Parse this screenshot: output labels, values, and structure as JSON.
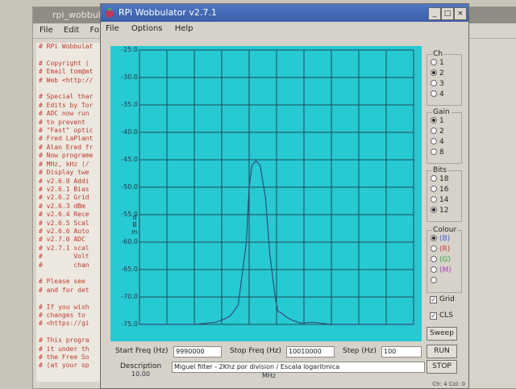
{
  "background_window": {
    "title": "rpi_wobbulator",
    "menu": [
      "File",
      "Edit",
      "Form"
    ],
    "text_lines": [
      "# RPi Wobbulat",
      "",
      "# Copyright (",
      "# Email tom@at",
      "# Web <http://",
      "",
      "# Special thar",
      "# Edits by Tor",
      "# ADC now run",
      "# to prevent",
      "# \"Fast\" optic",
      "# Fred LaPlant",
      "# Alan Ered fr",
      "# Now programe",
      "# MHz, kHz (/",
      "# Display twe",
      "# v2.6.0 Addi",
      "# v2.6.1 Bias",
      "# v2.6.2 Grid",
      "# v2.6.3 dBm",
      "# v2.6.4 Rece",
      "# v2.6.5 Scal",
      "# v2.6.6 Auto",
      "# v2.7.0 ADC",
      "# v2.7.1 scal",
      "#        Volt",
      "#        chan",
      "",
      "# Please see",
      "# and for det",
      "",
      "# If you wish",
      "# changes to",
      "# <https://gi",
      "",
      "# This progra",
      "# it under th",
      "# the Free So",
      "# (at your op"
    ]
  },
  "app": {
    "title": "RPi Wobbulator v2.7.1",
    "window_buttons": [
      "_",
      "□",
      "×"
    ],
    "menu": [
      "File",
      "Options",
      "Help"
    ]
  },
  "plot": {
    "y_ticks": [
      "-25.0",
      "-30.0",
      "-35.0",
      "-40.0",
      "-45.0",
      "-50.0",
      "-55.0",
      "-60.0",
      "-65.0",
      "-70.0",
      "-75.0"
    ],
    "ylabel": "dBm",
    "x_left_label": "10.00",
    "xlabel": "MHz",
    "background_color": "#27c9d3",
    "grid_color": "#1e4a55",
    "trace_color": "#2f4f7a"
  },
  "chart_data": {
    "type": "line",
    "xlabel": "MHz",
    "ylabel": "dBm",
    "ylim": [
      -75,
      -25
    ],
    "xlim": [
      0,
      10
    ],
    "grid": true,
    "legend": "none",
    "x": [
      0,
      1.0,
      2.0,
      2.8,
      3.1,
      3.3,
      3.6,
      3.9,
      4.0,
      4.1,
      4.25,
      4.4,
      4.6,
      4.75,
      4.95,
      5.05,
      5.2,
      5.4,
      5.6,
      5.9,
      6.3,
      7.0,
      8.0,
      9.0,
      10.0
    ],
    "values": [
      -75,
      -75,
      -75,
      -74.6,
      -74.0,
      -73.5,
      -71.5,
      -60,
      -50,
      -46,
      -45.2,
      -46,
      -52,
      -62,
      -70,
      -72.6,
      -73.0,
      -73.8,
      -74.3,
      -74.8,
      -74.6,
      -75,
      -75,
      -75,
      -75
    ]
  },
  "side": {
    "ch": {
      "title": "Ch",
      "options": [
        "1",
        "2",
        "3",
        "4"
      ],
      "selected": 1
    },
    "gain": {
      "title": "Gain",
      "options": [
        "1",
        "2",
        "4",
        "8"
      ],
      "selected": 0
    },
    "bits": {
      "title": "Bits",
      "options": [
        "18",
        "16",
        "14",
        "12"
      ],
      "selected": 3
    },
    "colour": {
      "title": "Colour",
      "options": [
        "(B)",
        "(R)",
        "(G)",
        "(M)",
        ""
      ],
      "selected": 0,
      "colors": [
        "#3d5fd0",
        "#c0392b",
        "#2e9e3a",
        "#a63cb8",
        "#888888"
      ]
    },
    "grid_label": "Grid",
    "cls_label": "CLS",
    "sweep_label": "Sweep",
    "run_label": "RUN",
    "stop_label": "STOP"
  },
  "form": {
    "start_label": "Start Freq (Hz)",
    "start_value": "9990000",
    "stop_label": "Stop Freq (Hz)",
    "stop_value": "10010000",
    "step_label": "Step (Hz)",
    "step_value": "100",
    "desc_label": "Description",
    "desc_value": "Miguel filter - 2Khz por division / Escala logaritmica"
  },
  "status": "Ch: 4 Col: 0"
}
